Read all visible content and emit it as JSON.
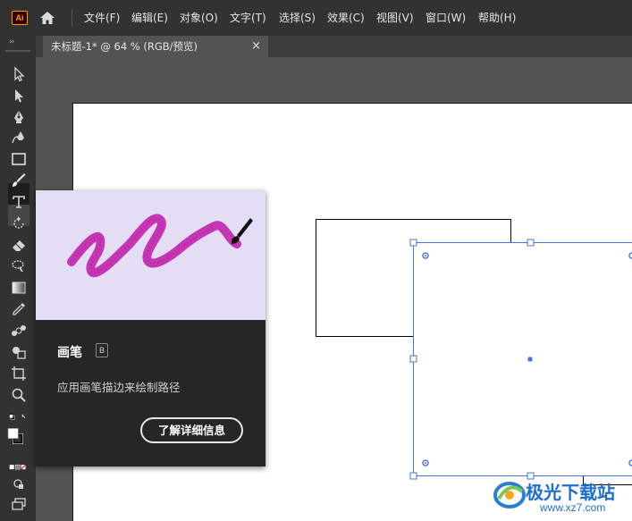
{
  "app": {
    "logo_text": "Ai",
    "brand_color": "#ff9a00"
  },
  "menu": {
    "items": [
      "文件(F)",
      "编辑(E)",
      "对象(O)",
      "文字(T)",
      "选择(S)",
      "效果(C)",
      "视图(V)",
      "窗口(W)",
      "帮助(H)"
    ]
  },
  "tab": {
    "title": "未标题-1* @ 64 % (RGB/预览)",
    "close_glyph": "×"
  },
  "toolbar": {
    "collapse_glyph": "››",
    "tools": [
      "selection-icon",
      "direct-selection-icon",
      "pen-icon",
      "curvature-icon",
      "rectangle-icon",
      "paintbrush-icon",
      "type-icon",
      "rotate-icon",
      "eraser-icon",
      "warp-icon",
      "gradient-icon",
      "eyedropper-icon",
      "blend-icon",
      "shape-builder-icon",
      "artboard-icon",
      "zoom-icon"
    ],
    "fill_color": "#ffffff",
    "stroke_color": "#000000"
  },
  "tooltip": {
    "title": "画笔",
    "shortcut": "B",
    "description": "应用画笔描边来绘制路径",
    "learn_more": "了解详细信息",
    "preview_color": "#c635b4"
  },
  "canvas": {
    "selection_color": "#4b73d8"
  },
  "watermark": {
    "name": "极光下载站",
    "url": "www.xz7.com"
  }
}
